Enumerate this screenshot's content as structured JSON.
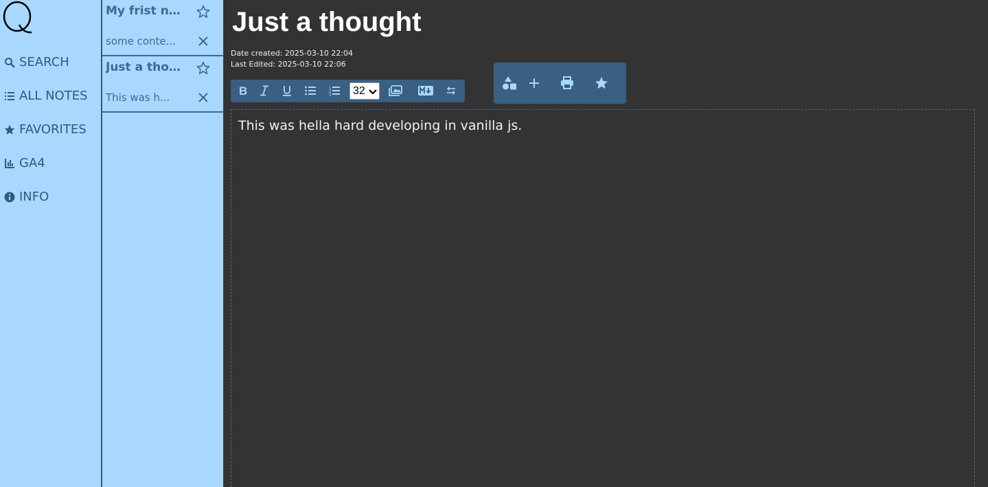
{
  "nav": {
    "items": [
      {
        "label": "SEARCH",
        "icon": "search-icon"
      },
      {
        "label": "ALL NOTES",
        "icon": "list-icon"
      },
      {
        "label": "FAVORITES",
        "icon": "star-icon"
      },
      {
        "label": "GA4",
        "icon": "bar-chart-icon"
      },
      {
        "label": "INFO",
        "icon": "info-icon"
      }
    ]
  },
  "notes": [
    {
      "title": "My frist n...",
      "content": "some conte...",
      "favorite": false
    },
    {
      "title": "Just a tho...",
      "content": "This was h...",
      "favorite": false
    }
  ],
  "note": {
    "title": "Just a thought",
    "created": "Date created: 2025-03-10 22:04",
    "edited": "Last Edited: 2025-03-10 22:06",
    "body": "This was hella hard developing in vanilla js."
  },
  "toolbar": {
    "font_size": "32"
  },
  "colors": {
    "sidebar_bg": "#a8d8ff",
    "accent": "#3a5f80",
    "editor_bg": "#333333"
  }
}
